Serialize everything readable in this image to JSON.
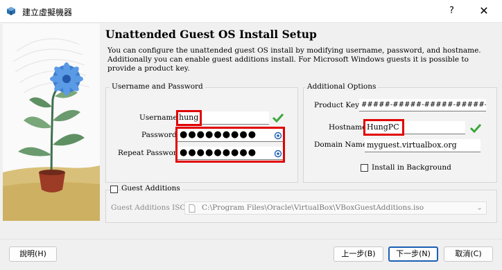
{
  "window": {
    "title": "建立虛擬機器",
    "help_label": "?",
    "close_label": "✕"
  },
  "page": {
    "heading": "Unattended Guest OS Install Setup",
    "description": "You can configure the unattended guest OS install by modifying username, password, and hostname. Additionally you can enable guest additions install. For Microsoft Windows guests it is possible to provide a product key."
  },
  "user_group": {
    "legend": "Username and Password",
    "username_label": "Username:",
    "username_value": "hung",
    "password_label": "Password:",
    "password_value": "●●●●●●●●●",
    "repeat_label": "Repeat Password:",
    "repeat_value": "●●●●●●●●●"
  },
  "options_group": {
    "legend": "Additional Options",
    "product_key_label": "Product Key:",
    "product_key_value": "#####-#####-#####-#####-#####",
    "hostname_label": "Hostname:",
    "hostname_value": "HungPC",
    "domain_label": "Domain Name:",
    "domain_value": "myguest.virtualbox.org",
    "install_bg_label": "Install in Background",
    "install_bg_checked": false
  },
  "guest_additions": {
    "label": "Guest Additions",
    "checked": false,
    "iso_label": "Guest Additions ISO:",
    "iso_value": "C:\\Program Files\\Oracle\\VirtualBox\\VBoxGuestAdditions.iso"
  },
  "buttons": {
    "help": "說明(H)",
    "back": "上一步(B)",
    "next": "下一步(N)",
    "cancel": "取消(C)"
  },
  "colors": {
    "highlight": "#e00000",
    "valid": "#3aa83a",
    "primary_border": "#1a5fb4"
  }
}
